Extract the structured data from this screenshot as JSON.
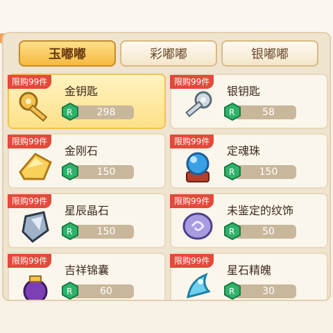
{
  "tabs": [
    {
      "label": "玉嘟嘟",
      "active": true
    },
    {
      "label": "彩嘟嘟",
      "active": false
    },
    {
      "label": "银嘟嘟",
      "active": false
    }
  ],
  "items": [
    {
      "tag": "限购99件",
      "name": "金钥匙",
      "price": "298",
      "icon": "gold-key-icon",
      "selected": true
    },
    {
      "tag": "限购99件",
      "name": "银钥匙",
      "price": "58",
      "icon": "silver-key-icon",
      "selected": false
    },
    {
      "tag": "限购99件",
      "name": "金刚石",
      "price": "150",
      "icon": "diamond-stone-icon",
      "selected": false
    },
    {
      "tag": "限购99件",
      "name": "定魂珠",
      "price": "150",
      "icon": "soul-orb-icon",
      "selected": false
    },
    {
      "tag": "限购99件",
      "name": "星辰晶石",
      "price": "150",
      "icon": "star-crystal-icon",
      "selected": false
    },
    {
      "tag": "限购99件",
      "name": "未鉴定的纹饰",
      "price": "50",
      "icon": "unidentified-emblem-icon",
      "selected": false
    },
    {
      "tag": "限购99件",
      "name": "吉祥锦囊",
      "price": "60",
      "icon": "lucky-pouch-icon",
      "selected": false
    },
    {
      "tag": "限购99件",
      "name": "星石精魄",
      "price": "30",
      "icon": "star-spirit-icon",
      "selected": false
    }
  ],
  "colors": {
    "accent": "#f5b93f",
    "tag_red": "#e4493a",
    "currency_green": "#2fb36a"
  }
}
